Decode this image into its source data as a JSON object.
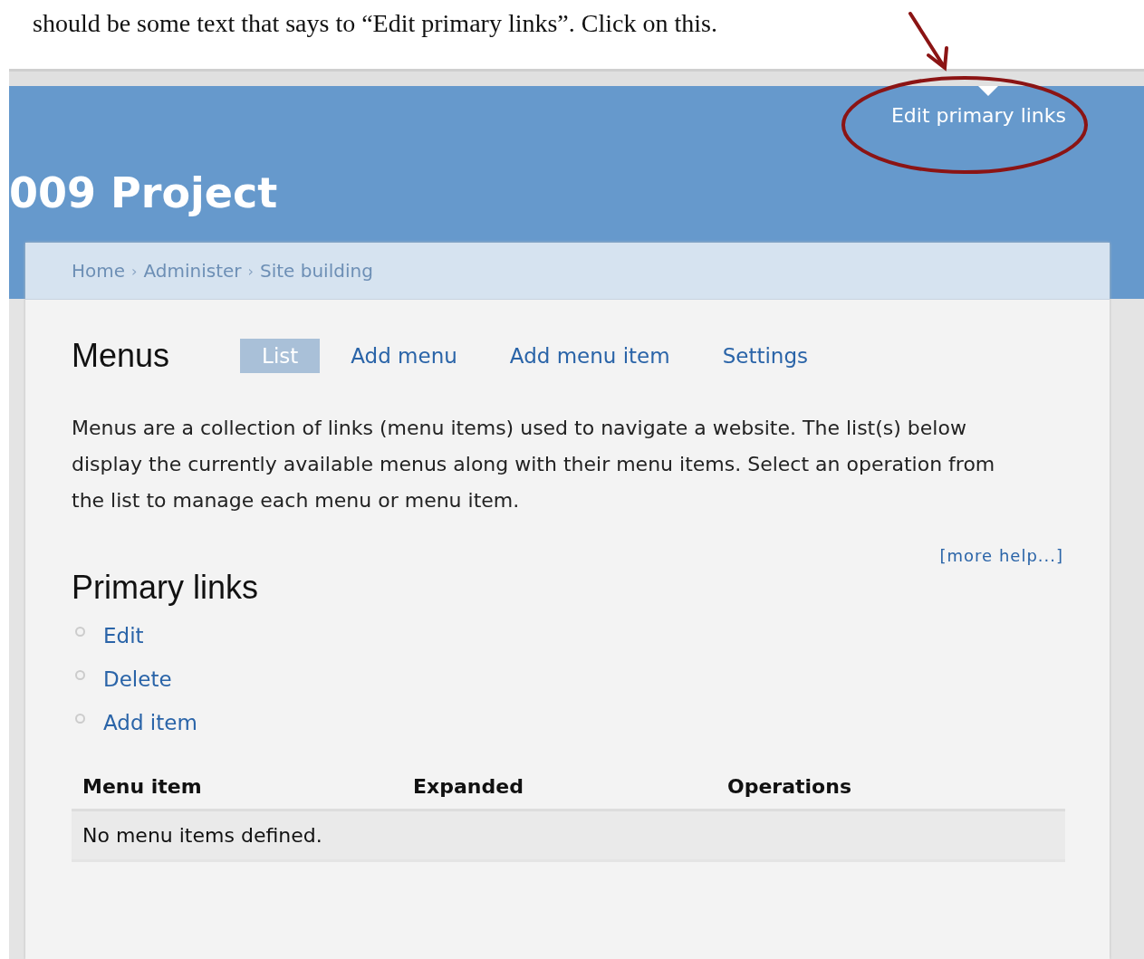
{
  "document_text": "should be some text that says to “Edit primary links”.  Click on this.",
  "header": {
    "site_name": "009 Project",
    "edit_link": "Edit primary links",
    "circled": true
  },
  "breadcrumb": {
    "separator": "›",
    "items": [
      "Home",
      "Administer",
      "Site building"
    ]
  },
  "page_title": "Menus",
  "tabs": [
    {
      "label": "List",
      "selected": true
    },
    {
      "label": "Add menu",
      "selected": false
    },
    {
      "label": "Add menu item",
      "selected": false
    },
    {
      "label": "Settings",
      "selected": false
    }
  ],
  "description": "Menus are a collection of links (menu items) used to navigate a website. The list(s) below display the currently available menus along with their menu items. Select an operation from the list to manage each menu or menu item.",
  "help_link": "[more help...]",
  "menu": {
    "title": "Primary links",
    "actions": [
      "Edit",
      "Delete",
      "Add item"
    ]
  },
  "table": {
    "columns": [
      "Menu item",
      "Expanded",
      "Operations"
    ],
    "empty_message": "No menu items defined."
  }
}
